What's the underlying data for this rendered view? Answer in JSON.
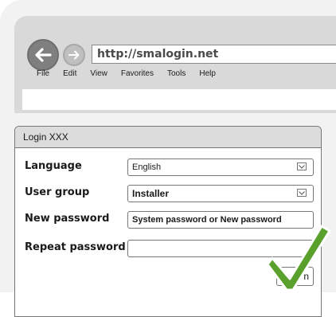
{
  "browser": {
    "address": "http://smalogin.net",
    "menu": [
      "File",
      "Edit",
      "View",
      "Favorites",
      "Tools",
      "Help"
    ]
  },
  "dialog": {
    "title": "Login XXX",
    "language": {
      "label": "Language",
      "value": "English"
    },
    "user_group": {
      "label": "User group",
      "value": "Installer"
    },
    "new_password": {
      "label": "New password",
      "value": "System password or New password"
    },
    "repeat_password": {
      "label": "Repeat password",
      "value": ""
    },
    "login_button": "n"
  },
  "colors": {
    "checkmark": "#5aa02c",
    "window_gray": "#d9d9d9",
    "border": "#777777"
  },
  "icons": [
    "back-arrow-icon",
    "forward-arrow-icon",
    "dropdown-caret-icon",
    "checkmark-icon"
  ]
}
